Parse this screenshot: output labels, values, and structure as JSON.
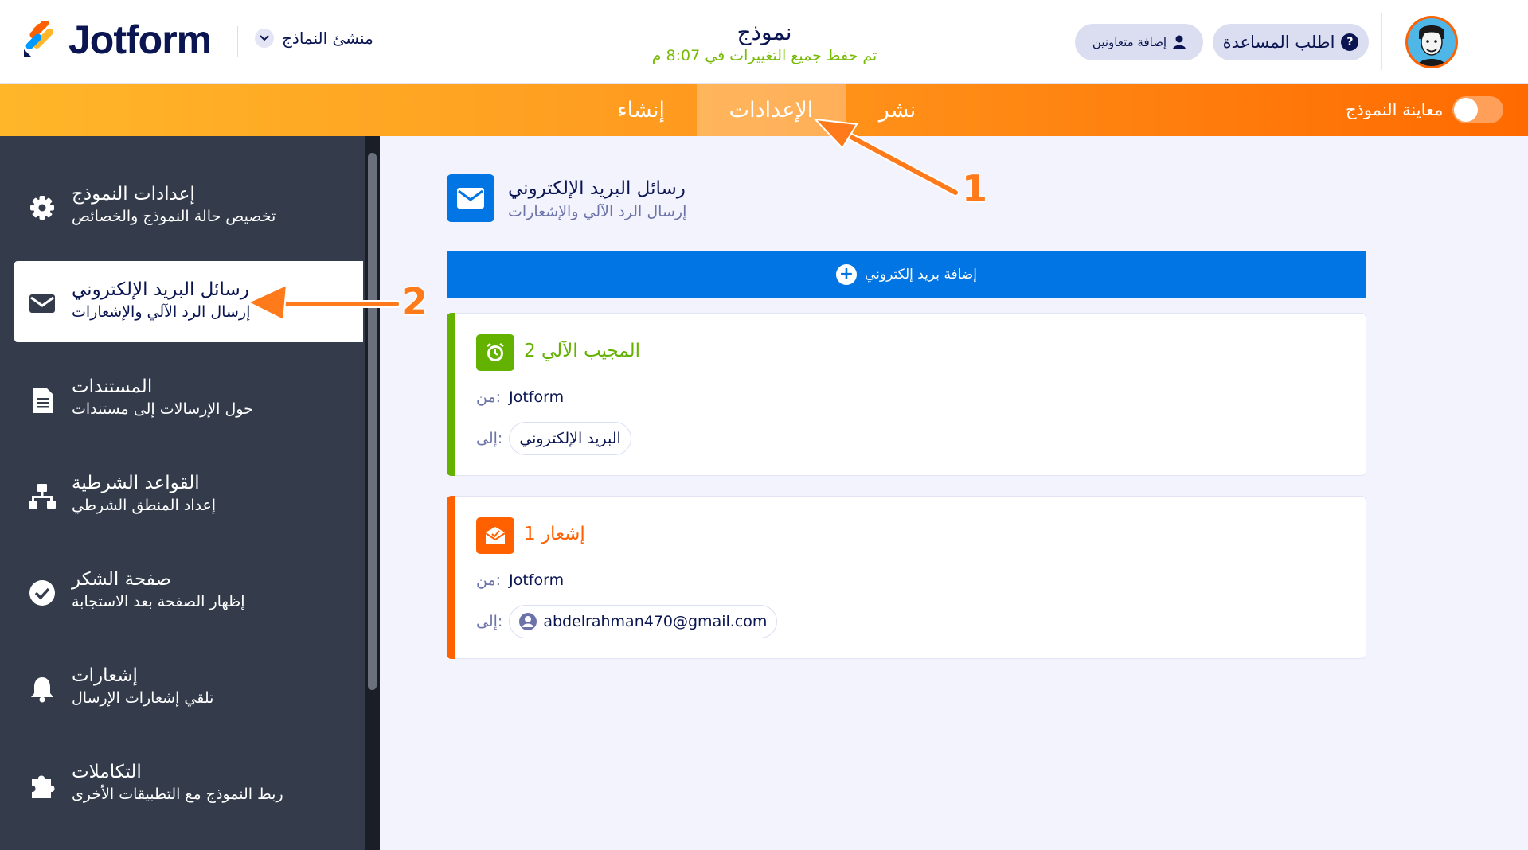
{
  "header": {
    "logo_text": "Jotform",
    "builder_label": "منشئ النماذج",
    "form_title": "نموذج",
    "save_status": "تم حفظ جميع التغييرات في 8:07 م",
    "collab_label": "إضافة متعاونين",
    "help_label": "اطلب المساعدة"
  },
  "nav": {
    "tabs": [
      {
        "label": "إنشاء"
      },
      {
        "label": "الإعدادات",
        "active": true
      },
      {
        "label": "نشر"
      }
    ],
    "preview_label": "معاينة النموذج",
    "preview_on": false
  },
  "sidebar": {
    "items": [
      {
        "title": "إعدادات النموذج",
        "subtitle": "تخصيص حالة النموذج والخصائص",
        "icon": "gear-icon"
      },
      {
        "title": "رسائل البريد الإلكتروني",
        "subtitle": "إرسال الرد الآلي والإشعارات",
        "icon": "envelope-icon",
        "active": true
      },
      {
        "title": "المستندات",
        "subtitle": "حول الإرسالات إلى مستندات",
        "icon": "document-icon"
      },
      {
        "title": "القواعد الشرطية",
        "subtitle": "إعداد المنطق الشرطي",
        "icon": "sitemap-icon"
      },
      {
        "title": "صفحة الشكر",
        "subtitle": "إظهار الصفحة بعد الاستجابة",
        "icon": "check-circle-icon"
      },
      {
        "title": "إشعارات",
        "subtitle": "تلقي إشعارات الإرسال",
        "icon": "bell-icon"
      },
      {
        "title": "التكاملات",
        "subtitle": "ربط النموذج مع التطبيقات الأخرى",
        "icon": "puzzle-icon"
      }
    ]
  },
  "main": {
    "section_title": "رسائل البريد الإلكتروني",
    "section_subtitle": "إرسال الرد الآلي والإشعارات",
    "add_email_label": "إضافة بريد إلكتروني",
    "cards": [
      {
        "title": "المجيب الآلي 2",
        "color": "#64b200",
        "icon": "alarm-clock-icon",
        "from_label": "من:",
        "from_value": "Jotform",
        "to_label": "إلى:",
        "to_value": "البريد الإلكتروني"
      },
      {
        "title": "إشعار 1",
        "color": "#ff6100",
        "icon": "mail-notification-icon",
        "from_label": "من:",
        "from_value": "Jotform",
        "to_label": "إلى:",
        "to_value": "abdelrahman470@gmail.com"
      }
    ]
  },
  "annotations": {
    "step1": "1",
    "step2": "2"
  },
  "colors": {
    "brand_orange": "#ff6100",
    "brand_blue": "#0075e3",
    "autoresponder_green": "#64b200",
    "sidebar_bg": "#343c4b"
  }
}
